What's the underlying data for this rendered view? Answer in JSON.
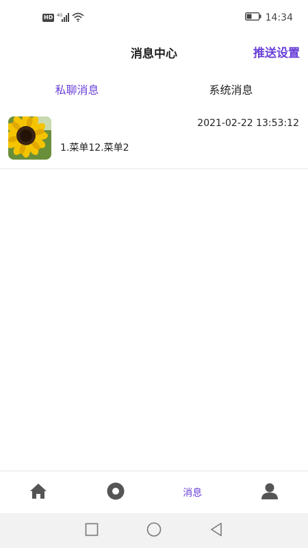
{
  "status_bar": {
    "hd_label": "HD",
    "network": "4G",
    "time": "14:34"
  },
  "header": {
    "title": "消息中心",
    "push_settings_label": "推送设置"
  },
  "tabs": [
    {
      "label": "私聊消息",
      "active": true
    },
    {
      "label": "系统消息",
      "active": false
    }
  ],
  "messages": [
    {
      "avatar_icon": "sunflower-avatar",
      "time": "2021-02-22 13:53:12",
      "preview": "1.菜单12.菜单2"
    }
  ],
  "tabbar": {
    "items": [
      {
        "icon": "home-icon",
        "label": ""
      },
      {
        "icon": "discover-icon",
        "label": ""
      },
      {
        "icon": "",
        "label": "消息",
        "active": true
      },
      {
        "icon": "user-icon",
        "label": ""
      }
    ]
  },
  "colors": {
    "accent": "#6a3fd8",
    "text": "#222222",
    "icon_gray": "#555555",
    "nav_bar_bg": "#f2f2f2"
  }
}
